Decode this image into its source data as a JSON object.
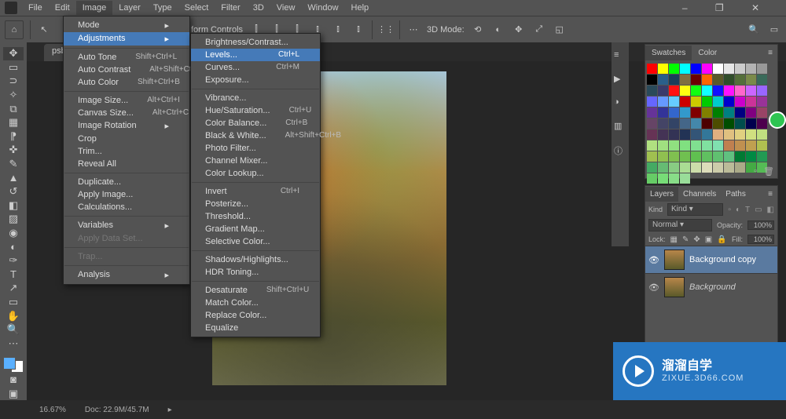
{
  "menubar": {
    "items": [
      "File",
      "Edit",
      "Image",
      "Layer",
      "Type",
      "Select",
      "Filter",
      "3D",
      "View",
      "Window",
      "Help"
    ],
    "open_index": 2
  },
  "optbar": {
    "label_transform": "form Controls",
    "mode_label": "3D Mode:"
  },
  "doc_tab": "psb.",
  "status": {
    "zoom": "16.67%",
    "doc": "Doc: 22.9M/45.7M"
  },
  "image_menu": {
    "items": [
      {
        "label": "Mode",
        "arrow": true
      },
      {
        "label": "Adjustments",
        "arrow": true,
        "hover": true
      },
      {
        "sep": true
      },
      {
        "label": "Auto Tone",
        "shortcut": "Shift+Ctrl+L"
      },
      {
        "label": "Auto Contrast",
        "shortcut": "Alt+Shift+Ctrl+L"
      },
      {
        "label": "Auto Color",
        "shortcut": "Shift+Ctrl+B"
      },
      {
        "sep": true
      },
      {
        "label": "Image Size...",
        "shortcut": "Alt+Ctrl+I"
      },
      {
        "label": "Canvas Size...",
        "shortcut": "Alt+Ctrl+C"
      },
      {
        "label": "Image Rotation",
        "arrow": true
      },
      {
        "label": "Crop"
      },
      {
        "label": "Trim..."
      },
      {
        "label": "Reveal All"
      },
      {
        "sep": true
      },
      {
        "label": "Duplicate..."
      },
      {
        "label": "Apply Image..."
      },
      {
        "label": "Calculations..."
      },
      {
        "sep": true
      },
      {
        "label": "Variables",
        "arrow": true
      },
      {
        "label": "Apply Data Set...",
        "disabled": true
      },
      {
        "sep": true
      },
      {
        "label": "Trap...",
        "disabled": true
      },
      {
        "sep": true
      },
      {
        "label": "Analysis",
        "arrow": true
      }
    ]
  },
  "adjust_menu": {
    "items": [
      {
        "label": "Brightness/Contrast..."
      },
      {
        "label": "Levels...",
        "shortcut": "Ctrl+L",
        "hover": true
      },
      {
        "label": "Curves...",
        "shortcut": "Ctrl+M"
      },
      {
        "label": "Exposure..."
      },
      {
        "sep": true
      },
      {
        "label": "Vibrance..."
      },
      {
        "label": "Hue/Saturation...",
        "shortcut": "Ctrl+U"
      },
      {
        "label": "Color Balance...",
        "shortcut": "Ctrl+B"
      },
      {
        "label": "Black & White...",
        "shortcut": "Alt+Shift+Ctrl+B"
      },
      {
        "label": "Photo Filter..."
      },
      {
        "label": "Channel Mixer..."
      },
      {
        "label": "Color Lookup..."
      },
      {
        "sep": true
      },
      {
        "label": "Invert",
        "shortcut": "Ctrl+I"
      },
      {
        "label": "Posterize..."
      },
      {
        "label": "Threshold..."
      },
      {
        "label": "Gradient Map..."
      },
      {
        "label": "Selective Color..."
      },
      {
        "sep": true
      },
      {
        "label": "Shadows/Highlights..."
      },
      {
        "label": "HDR Toning..."
      },
      {
        "sep": true
      },
      {
        "label": "Desaturate",
        "shortcut": "Shift+Ctrl+U"
      },
      {
        "label": "Match Color..."
      },
      {
        "label": "Replace Color..."
      },
      {
        "label": "Equalize"
      }
    ]
  },
  "swatches": {
    "tabs": [
      "Swatches",
      "Color"
    ],
    "colors": [
      "#ff0000",
      "#ffff00",
      "#00ff00",
      "#00ffff",
      "#0000ff",
      "#ff00ff",
      "#ffffff",
      "#e6e6e6",
      "#cccccc",
      "#b3b3b3",
      "#999999",
      "#000000",
      "#2a5f8a",
      "#1b3e5a",
      "#807040",
      "#6c0000",
      "#ff6600",
      "#5a5a2a",
      "#304d2a",
      "#546e3a",
      "#7a8a4a",
      "#3a6a5a",
      "#2a4a5a",
      "#3a3a6a",
      "#ff1111",
      "#ffff11",
      "#11ff11",
      "#11ffff",
      "#1111ff",
      "#ff11ff",
      "#ff66cc",
      "#cc66ff",
      "#9966ff",
      "#6666ff",
      "#6699ff",
      "#66ccff",
      "#cc0000",
      "#cccc00",
      "#00cc00",
      "#00cccc",
      "#0000cc",
      "#cc00cc",
      "#cc3399",
      "#993399",
      "#663399",
      "#333399",
      "#3366cc",
      "#3399cc",
      "#800000",
      "#808000",
      "#008000",
      "#008080",
      "#000080",
      "#800080",
      "#994466",
      "#664466",
      "#444466",
      "#334466",
      "#446688",
      "#4488aa",
      "#4d0000",
      "#4d4d00",
      "#004d00",
      "#004d4d",
      "#00004d",
      "#4d004d",
      "#663355",
      "#443355",
      "#333355",
      "#223355",
      "#335577",
      "#337799",
      "#e0b080",
      "#e0c080",
      "#e0d080",
      "#d0e080",
      "#c0e080",
      "#b0e080",
      "#a0e080",
      "#90e080",
      "#80e080",
      "#80e090",
      "#80e0a0",
      "#80e0b0",
      "#c08050",
      "#c09050",
      "#c0a050",
      "#b0c050",
      "#a0c050",
      "#90c050",
      "#80c050",
      "#70c050",
      "#60c050",
      "#60c060",
      "#60c070",
      "#60c080",
      "#007a33",
      "#008a43",
      "#229a53",
      "#44aa63",
      "#66bb73",
      "#88cc83",
      "#aadd93",
      "#ccddaa",
      "#ddddbb",
      "#ccccaa",
      "#bbbb99",
      "#aaaa88",
      "#44aa44",
      "#55bb55",
      "#66cc66",
      "#77dd77",
      "#88dd88",
      "#99dd99"
    ]
  },
  "layers": {
    "tabs": [
      "Layers",
      "Channels",
      "Paths"
    ],
    "kind_label": "Kind",
    "blend": "Normal",
    "opacity_label": "Opacity:",
    "opacity": "100%",
    "lock_label": "Lock:",
    "fill_label": "Fill:",
    "fill": "100%",
    "items": [
      {
        "name": "Background copy",
        "selected": true,
        "italic": false
      },
      {
        "name": "Background",
        "selected": false,
        "italic": true
      }
    ]
  },
  "watermark": {
    "title": "溜溜自学",
    "sub": "ZIXUE.3D66.COM"
  }
}
